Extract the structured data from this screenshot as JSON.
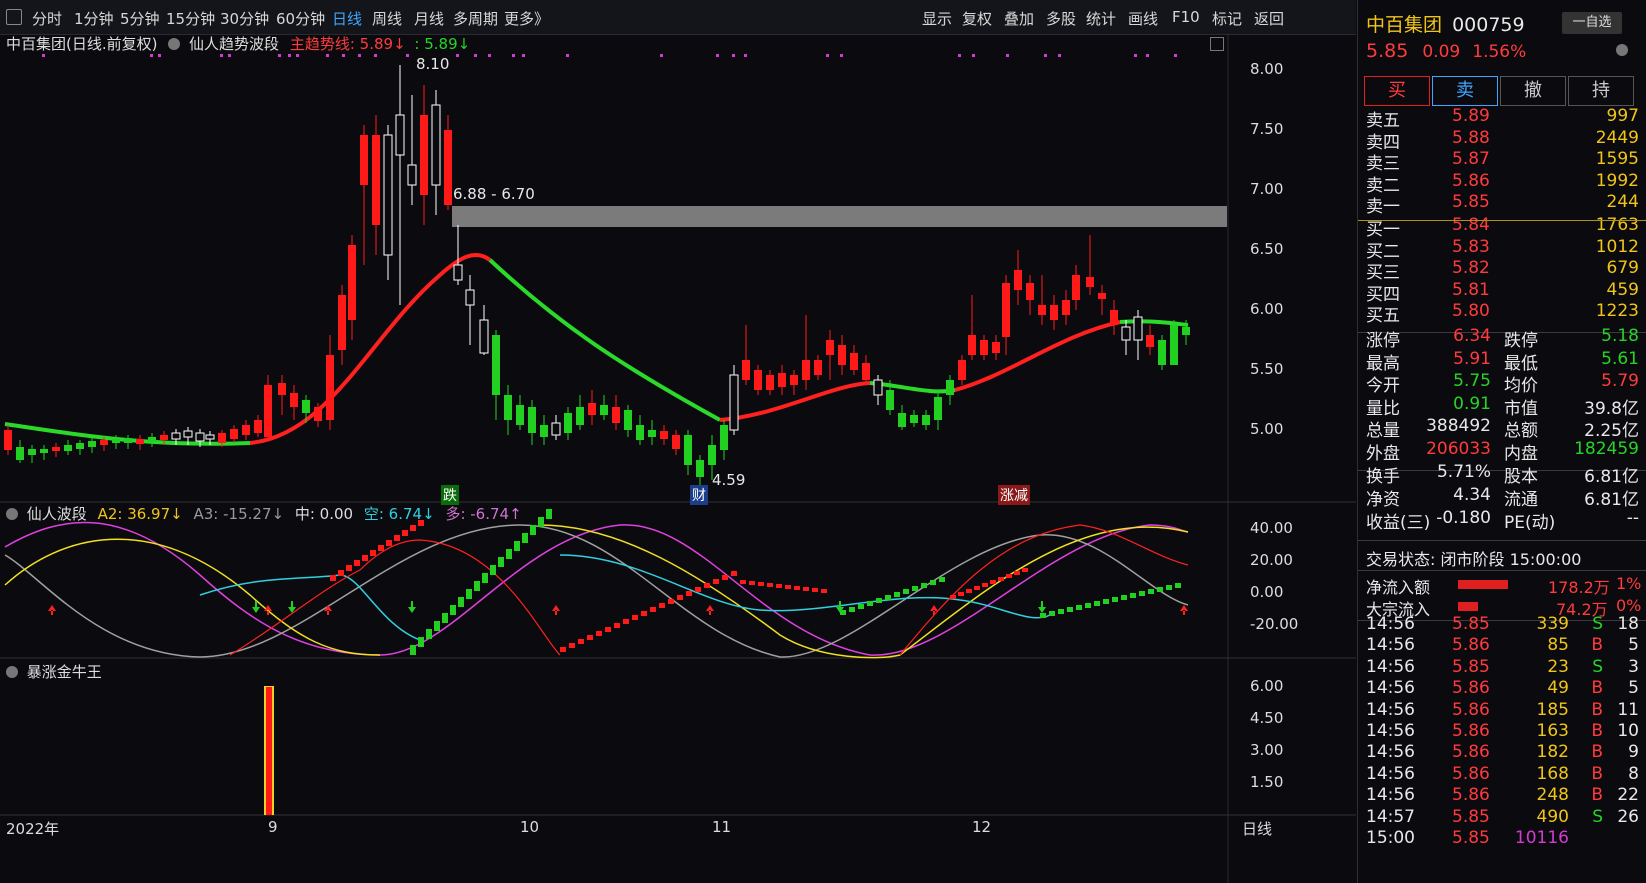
{
  "toolbar": {
    "left": [
      "分时",
      "1分钟",
      "5分钟",
      "15分钟",
      "30分钟",
      "60分钟",
      "日线",
      "周线",
      "月线",
      "多周期",
      "更多》"
    ],
    "right": [
      "显示",
      "复权",
      "叠加",
      "多股",
      "统计",
      "画线",
      "F10",
      "标记",
      "返回"
    ],
    "active": "日线"
  },
  "main_header": {
    "title": "中百集团(日线.前复权)",
    "indicator": "仙人趋势波段",
    "trend_label": "主趋势线: 5.89↓",
    "trend_value2": ": 5.89↓"
  },
  "main_chart": {
    "y_ticks": [
      "8.00",
      "7.50",
      "7.00",
      "6.50",
      "6.00",
      "5.50",
      "5.00"
    ],
    "high_label": "8.10",
    "low_label": "4.59",
    "zone_label": "6.88 - 6.70",
    "tags": [
      "跌",
      "财",
      "涨减"
    ]
  },
  "osc_header": {
    "name": "仙人波段",
    "a2": "A2: 36.97↓",
    "a3": "A3: -15.27↓",
    "mid": "中: 0.00",
    "kong": "空: 6.74↓",
    "duo": "多: -6.74↑"
  },
  "osc_chart": {
    "y_ticks": [
      "40.00",
      "20.00",
      "0.00",
      "-20.00"
    ]
  },
  "vol_header": {
    "name": "暴涨金牛王"
  },
  "vol_chart": {
    "y_ticks": [
      "6.00",
      "4.50",
      "3.00",
      "1.50"
    ]
  },
  "x_axis": {
    "labels": [
      "2022年",
      "9",
      "10",
      "11",
      "12"
    ],
    "period": "日线"
  },
  "quote": {
    "name": "中百集团",
    "code": "000759",
    "watch": "一自选",
    "price": "5.85",
    "change": "0.09",
    "pct": "1.56%",
    "buttons": [
      "买",
      "卖",
      "撤",
      "持"
    ],
    "asks": [
      {
        "label": "卖五",
        "price": "5.89",
        "vol": "997"
      },
      {
        "label": "卖四",
        "price": "5.88",
        "vol": "2449"
      },
      {
        "label": "卖三",
        "price": "5.87",
        "vol": "1595"
      },
      {
        "label": "卖二",
        "price": "5.86",
        "vol": "1992"
      },
      {
        "label": "卖一",
        "price": "5.85",
        "vol": "244"
      }
    ],
    "bids": [
      {
        "label": "买一",
        "price": "5.84",
        "vol": "1763"
      },
      {
        "label": "买二",
        "price": "5.83",
        "vol": "1012"
      },
      {
        "label": "买三",
        "price": "5.82",
        "vol": "679"
      },
      {
        "label": "买四",
        "price": "5.81",
        "vol": "459"
      },
      {
        "label": "买五",
        "price": "5.80",
        "vol": "1223"
      }
    ],
    "stats": [
      {
        "l1": "涨停",
        "v1": "6.34",
        "c1": "red",
        "l2": "跌停",
        "v2": "5.18",
        "c2": "green"
      },
      {
        "l1": "最高",
        "v1": "5.91",
        "c1": "red",
        "l2": "最低",
        "v2": "5.61",
        "c2": "green"
      },
      {
        "l1": "今开",
        "v1": "5.75",
        "c1": "green",
        "l2": "均价",
        "v2": "5.79",
        "c2": "red"
      },
      {
        "l1": "量比",
        "v1": "0.91",
        "c1": "green",
        "l2": "市值",
        "v2": "39.8亿",
        "c2": "white"
      },
      {
        "l1": "总量",
        "v1": "388492",
        "c1": "white",
        "l2": "总额",
        "v2": "2.25亿",
        "c2": "white"
      },
      {
        "l1": "外盘",
        "v1": "206033",
        "c1": "red",
        "l2": "内盘",
        "v2": "182459",
        "c2": "green"
      }
    ],
    "stats2": [
      {
        "l1": "换手",
        "v1": "5.71%",
        "l2": "股本",
        "v2": "6.81亿"
      },
      {
        "l1": "净资",
        "v1": "4.34",
        "l2": "流通",
        "v2": "6.81亿"
      },
      {
        "l1": "收益(三)",
        "v1": "-0.180",
        "l2": "PE(动)",
        "v2": "--"
      }
    ],
    "status": "交易状态: 闭市阶段 15:00:00",
    "netflow": {
      "label": "净流入额",
      "value": "178.2万",
      "pct": "1%"
    },
    "bigflow": {
      "label": "大宗流入",
      "value": "74.2万",
      "pct": "0%"
    },
    "ticks": [
      {
        "t": "14:56",
        "p": "5.85",
        "v": "339",
        "s": "S",
        "n": "18"
      },
      {
        "t": "14:56",
        "p": "5.86",
        "v": "85",
        "s": "B",
        "n": "5"
      },
      {
        "t": "14:56",
        "p": "5.85",
        "v": "23",
        "s": "S",
        "n": "3"
      },
      {
        "t": "14:56",
        "p": "5.86",
        "v": "49",
        "s": "B",
        "n": "5"
      },
      {
        "t": "14:56",
        "p": "5.86",
        "v": "185",
        "s": "B",
        "n": "11"
      },
      {
        "t": "14:56",
        "p": "5.86",
        "v": "163",
        "s": "B",
        "n": "10"
      },
      {
        "t": "14:56",
        "p": "5.86",
        "v": "182",
        "s": "B",
        "n": "9"
      },
      {
        "t": "14:56",
        "p": "5.86",
        "v": "168",
        "s": "B",
        "n": "8"
      },
      {
        "t": "14:56",
        "p": "5.86",
        "v": "248",
        "s": "B",
        "n": "22"
      },
      {
        "t": "14:57",
        "p": "5.85",
        "v": "490",
        "s": "S",
        "n": "26"
      },
      {
        "t": "15:00",
        "p": "5.85",
        "v": "10116",
        "s": "",
        "n": ""
      }
    ]
  }
}
